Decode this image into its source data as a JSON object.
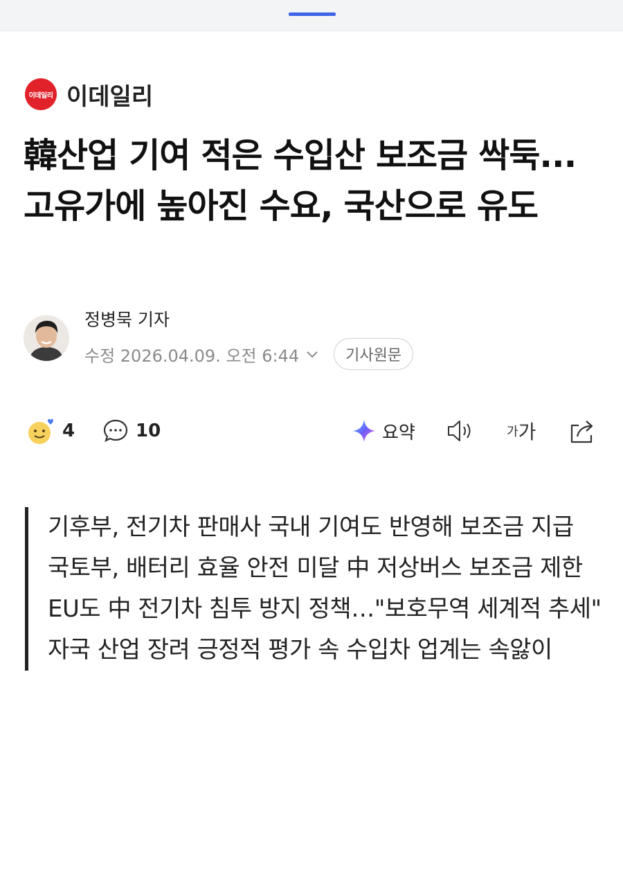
{
  "publisher": {
    "logo_text": "이데일리",
    "name": "이데일리",
    "brand_color": "#e1222b"
  },
  "headline": "韓산업 기여 적은 수입산 보조금 싹둑...고유가에 높아진 수요, 국산으로 유도",
  "byline": {
    "author": "정병묵 기자",
    "timestamp": "수정 2026.04.09. 오전 6:44",
    "expand_icon": "chevron-down-icon",
    "original_label": "기사원문"
  },
  "actions": {
    "reaction_icon": "smiley-reaction-icon",
    "reaction_count": "4",
    "comment_icon": "comment-bubble-icon",
    "comment_count": "10",
    "summary_icon": "ai-sparkle-icon",
    "summary_label": "요약",
    "audio_icon": "speaker-icon",
    "font_size_label": "가가",
    "share_icon": "share-icon"
  },
  "summary_lines": [
    "기후부, 전기차 판매사 국내 기여도 반영해 보조금 지급",
    "국토부, 배터리 효율 안전 미달 中 저상버스 보조금 제한",
    "EU도 中 전기차 침투 방지 정책…\"보호무역 세계적 추세\"",
    "자국 산업 장려 긍정적 평가 속 수입차 업계는 속앓이"
  ],
  "colors": {
    "accent_indicator": "#3d63e8",
    "text_primary": "#111111",
    "text_secondary": "#8a8a8a"
  }
}
